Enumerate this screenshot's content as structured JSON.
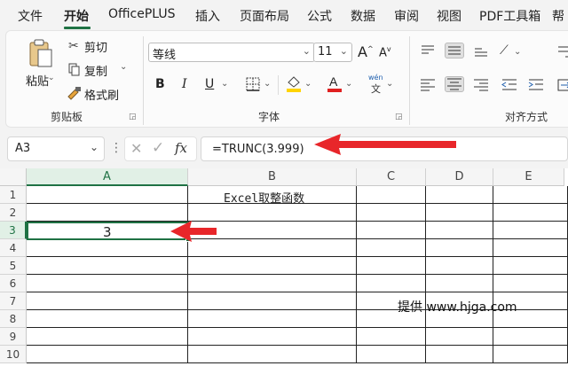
{
  "menu": {
    "items": [
      "文件",
      "开始",
      "OfficePLUS",
      "插入",
      "页面布局",
      "公式",
      "数据",
      "审阅",
      "视图",
      "PDF工具箱",
      "帮"
    ],
    "active_index": 1,
    "accent": "#1f7244"
  },
  "ribbon": {
    "clipboard": {
      "paste_label": "粘贴",
      "cut_label": "剪切",
      "copy_label": "复制",
      "format_painter_label": "格式刷",
      "group_label": "剪贴板"
    },
    "font": {
      "font_name": "等线",
      "font_size": "11",
      "grow_label": "A",
      "shrink_label": "A",
      "bold_label": "B",
      "italic_label": "I",
      "underline_label": "U",
      "phonetic_top": "wén",
      "phonetic_bottom": "文",
      "font_color_label": "A",
      "group_label": "字体",
      "fill_color": "#ffd400",
      "font_color": "#e02020"
    },
    "alignment": {
      "group_label": "对齐方式"
    }
  },
  "formula_bar": {
    "name_box": "A3",
    "fx_label": "fx",
    "formula": "=TRUNC(3.999)"
  },
  "sheet": {
    "columns": [
      "A",
      "B",
      "C",
      "D",
      "E"
    ],
    "rows": [
      "1",
      "2",
      "3",
      "4",
      "5",
      "6",
      "7",
      "8",
      "9",
      "10"
    ],
    "selected_cell": "A3",
    "b1_value": "Excel取整函数",
    "a3_value": "3",
    "watermark": "提供 www.hjga.com"
  },
  "annotations": {
    "arrow_color": "#e8262a"
  }
}
